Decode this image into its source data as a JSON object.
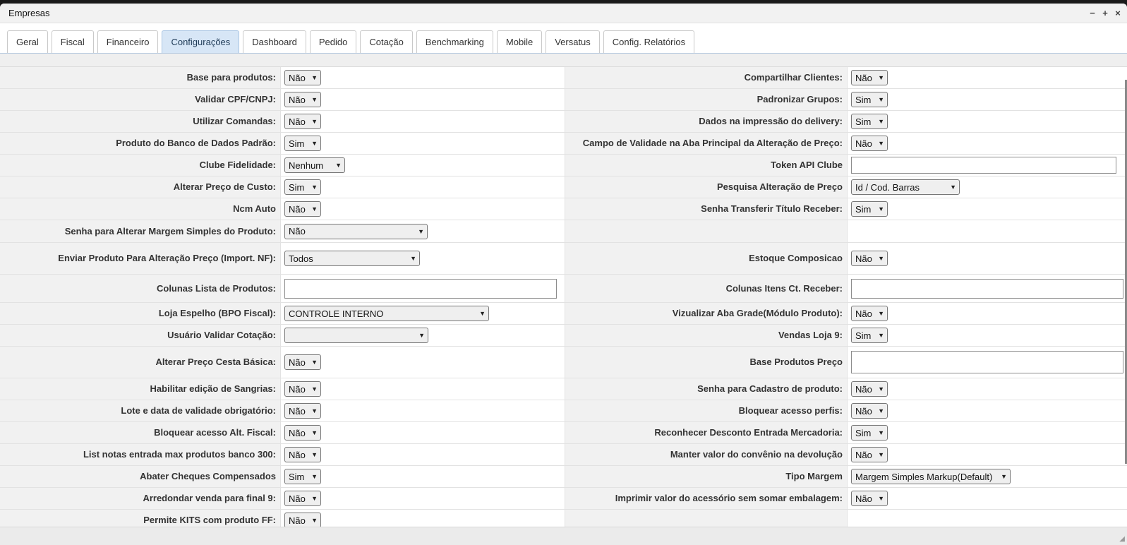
{
  "window": {
    "title": "Empresas",
    "minimize": "−",
    "maximize": "+",
    "close": "×"
  },
  "tabs": [
    {
      "label": "Geral"
    },
    {
      "label": "Fiscal"
    },
    {
      "label": "Financeiro"
    },
    {
      "label": "Configurações",
      "active": true
    },
    {
      "label": "Dashboard"
    },
    {
      "label": "Pedido"
    },
    {
      "label": "Cotação"
    },
    {
      "label": "Benchmarking"
    },
    {
      "label": "Mobile"
    },
    {
      "label": "Versatus"
    },
    {
      "label": "Config. Relatórios"
    }
  ],
  "rows": [
    {
      "l": "Base para produtos:",
      "lv": "Não",
      "r": "Compartilhar Clientes:",
      "rv": "Não"
    },
    {
      "l": "Validar CPF/CNPJ:",
      "lv": "Não",
      "r": "Padronizar Grupos:",
      "rv": "Sim"
    },
    {
      "l": "Utilizar Comandas:",
      "lv": "Não",
      "r": "Dados na impressão do delivery:",
      "rv": "Sim"
    },
    {
      "l": "Produto do Banco de Dados Padrão:",
      "lv": "Sim",
      "r": "Campo de Validade na Aba Principal da Alteração de Preço:",
      "rv": "Não"
    },
    {
      "l": "Clube Fidelidade:",
      "lv": "Nenhum",
      "r": "Token API Clube",
      "rv": ""
    },
    {
      "l": "Alterar Preço de Custo:",
      "lv": "Sim",
      "r": "Pesquisa Alteração de Preço",
      "rv": "Id / Cod. Barras"
    },
    {
      "l": "Ncm Auto",
      "lv": "Não",
      "r": "Senha Transferir Título Receber:",
      "rv": "Sim"
    },
    {
      "l": "Senha para Alterar Margem Simples do Produto:",
      "lv": "Não",
      "r": "",
      "rv": ""
    },
    {
      "l": "Enviar Produto Para Alteração Preço (Import. NF):",
      "lv": "Todos",
      "r": "Estoque Composicao",
      "rv": "Não"
    },
    {
      "l": "Colunas Lista de Produtos:",
      "lv": "",
      "r": "Colunas Itens Ct. Receber:",
      "rv": ""
    },
    {
      "l": "Loja Espelho (BPO Fiscal):",
      "lv": "CONTROLE INTERNO",
      "r": "Vizualizar Aba Grade(Módulo Produto):",
      "rv": "Não"
    },
    {
      "l": "Usuário Validar Cotação:",
      "lv": "",
      "r": "Vendas Loja 9:",
      "rv": "Sim"
    },
    {
      "l": "Alterar Preço Cesta Básica:",
      "lv": "Não",
      "r": "Base Produtos Preço",
      "rv": ""
    },
    {
      "l": "Habilitar edição de Sangrias:",
      "lv": "Não",
      "r": "Senha para Cadastro de produto:",
      "rv": "Não"
    },
    {
      "l": "Lote e data de validade obrigatório:",
      "lv": "Não",
      "r": "Bloquear acesso perfis:",
      "rv": "Não"
    },
    {
      "l": "Bloquear acesso Alt. Fiscal:",
      "lv": "Não",
      "r": "Reconhecer Desconto Entrada Mercadoria:",
      "rv": "Sim"
    },
    {
      "l": "List notas entrada max produtos banco 300:",
      "lv": "Não",
      "r": "Manter valor do convênio na devolução",
      "rv": "Não"
    },
    {
      "l": "Abater Cheques Compensados",
      "lv": "Sim",
      "r": "Tipo Margem",
      "rv": "Margem Simples Markup(Default)"
    },
    {
      "l": "Arredondar venda para final 9:",
      "lv": "Não",
      "r": "Imprimir valor do acessório sem somar embalagem:",
      "rv": "Não"
    },
    {
      "l": "Permite KITS com produto FF:",
      "lv": "Não",
      "r": "",
      "rv": ""
    }
  ]
}
